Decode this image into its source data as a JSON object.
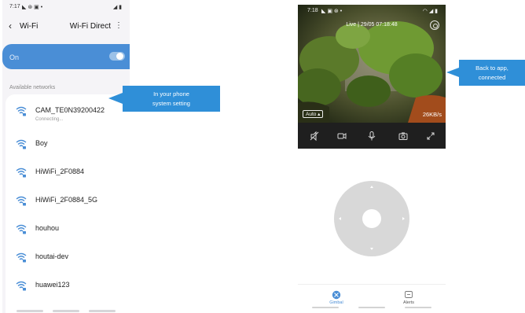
{
  "left_phone": {
    "status": {
      "time": "7:17",
      "icons_left": "◣ ⊛ ▣ •",
      "icons_right": "◢ ▮"
    },
    "header": {
      "back_icon": "‹",
      "title": "Wi-Fi",
      "wifi_direct": "Wi-Fi Direct",
      "more_icon": "⋮"
    },
    "toggle_label": "On",
    "toggle_on": true,
    "available_label": "Available networks",
    "networks": [
      {
        "name": "CAM_TE0N39200422",
        "status": "Connecting..."
      },
      {
        "name": "Boy",
        "status": ""
      },
      {
        "name": "HiWiFi_2F0884",
        "status": ""
      },
      {
        "name": "HiWiFi_2F0884_5G",
        "status": ""
      },
      {
        "name": "houhou",
        "status": ""
      },
      {
        "name": "houtai-dev",
        "status": ""
      },
      {
        "name": "huawei123",
        "status": ""
      }
    ]
  },
  "callouts": {
    "phone_setting": {
      "line1": "In your phone",
      "line2": "system setting"
    },
    "back_to_app": {
      "line1": "Back to app,",
      "line2": "connected"
    }
  },
  "right_phone": {
    "status": {
      "time": "7:18",
      "icons_left": "◣ ▣ ⊛ •",
      "icons_right": "◠ ◢ ▮"
    },
    "live_label": "Live | 29/05 07:18:48",
    "quality_button": "Auto ▴",
    "data_rate": "26KB/s",
    "controls": [
      "mute-icon",
      "record-icon",
      "microphone-icon",
      "snapshot-icon",
      "fullscreen-icon"
    ],
    "tabs": [
      {
        "label": "Gimbal",
        "icon": "gimbal-icon",
        "active": true
      },
      {
        "label": "Alerts",
        "icon": "alerts-icon",
        "active": false
      }
    ]
  },
  "colors": {
    "accent": "#4a8ed6",
    "callout": "#2f8fd8",
    "controls_bg": "#1f1f1f",
    "pad": "#d8d8d8"
  }
}
